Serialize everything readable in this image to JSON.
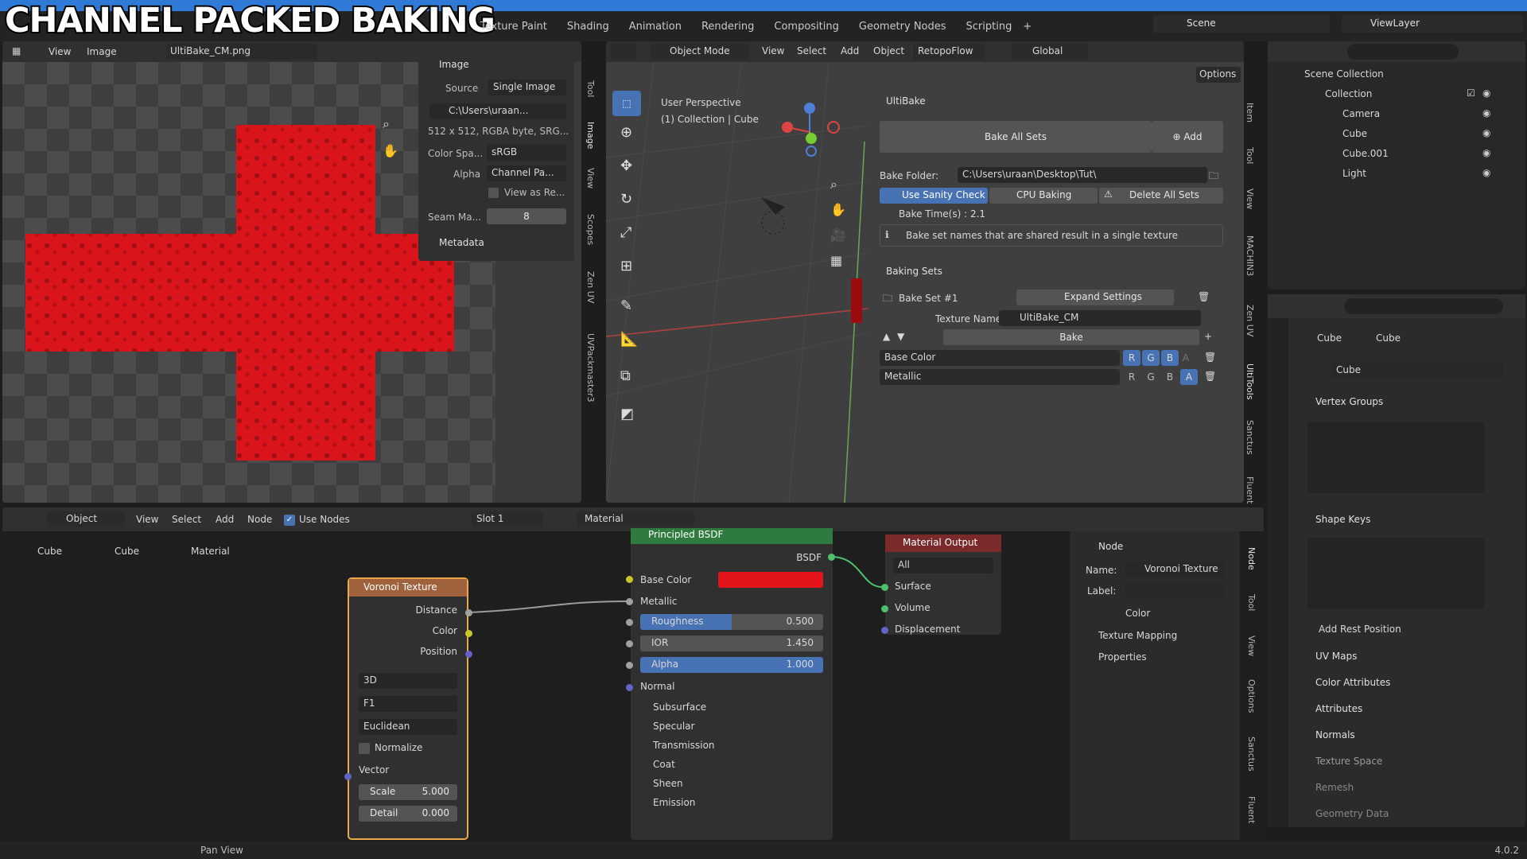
{
  "overlay": {
    "title": "CHANNEL PACKED BAKING"
  },
  "topbar": {
    "tabs": [
      "Texture Paint",
      "Shading",
      "Animation",
      "Rendering",
      "Compositing",
      "Geometry Nodes",
      "Scripting"
    ],
    "plus": "+",
    "scene": "Scene",
    "viewlayer": "ViewLayer"
  },
  "image_editor": {
    "menu": [
      "View",
      "Image"
    ],
    "image_name": "UltiBake_CM.png",
    "panel": {
      "title": "Image",
      "source_label": "Source",
      "source_value": "Single Image",
      "path": "C:\\Users\\uraan...",
      "info": "512 x 512, RGBA byte, SRG...",
      "colorspace_label": "Color Spa...",
      "colorspace_value": "sRGB",
      "alpha_label": "Alpha",
      "alpha_value": "Channel Pa...",
      "view_as": "View as Re...",
      "seam_label": "Seam Ma...",
      "seam_value": "8",
      "metadata": "Metadata"
    },
    "tabs": [
      "Tool",
      "Image",
      "View",
      "Scopes",
      "Zen UV",
      "UVPackmaster3"
    ]
  },
  "viewport": {
    "mode": "Object Mode",
    "menu": [
      "View",
      "Select",
      "Add",
      "Object"
    ],
    "retopo": "RetopoFlow",
    "orientation": "Global",
    "options": "Options",
    "perspective": "User Perspective",
    "collection": "(1) Collection | Cube",
    "tabs": [
      "Item",
      "Tool",
      "View",
      "MACHIN3",
      "Zen UV",
      "UltiTools",
      "Sanctus",
      "Fluent"
    ]
  },
  "ultibake": {
    "title": "UltiBake",
    "bake_all": "Bake All Sets",
    "add": "Add",
    "folder_label": "Bake Folder:",
    "folder_value": "C:\\Users\\uraan\\Desktop\\Tut\\",
    "sanity": "Use Sanity Check",
    "cpu": "CPU Baking",
    "delete_all": "Delete All Sets",
    "bake_time": "Bake Time(s) : 2.1",
    "note": "Bake set names that are shared result in a single texture",
    "sets_title": "Baking Sets",
    "set_name": "Bake Set #1",
    "expand": "Expand Settings",
    "texture_label": "Texture Name :",
    "texture_value": "UltiBake_CM",
    "bake": "Bake",
    "rows": [
      {
        "map": "Base Color",
        "channels": [
          "R",
          "G",
          "B",
          "A"
        ],
        "active": [
          true,
          true,
          true,
          false
        ]
      },
      {
        "map": "Metallic",
        "channels": [
          "R",
          "G",
          "B",
          "A"
        ],
        "active": [
          false,
          false,
          false,
          true
        ]
      }
    ]
  },
  "outliner": {
    "title": "Scene Collection",
    "items": [
      "Collection",
      "Camera",
      "Cube",
      "Cube.001",
      "Light"
    ]
  },
  "properties": {
    "crumb_obj": "Cube",
    "crumb_mesh": "Cube",
    "mesh_name": "Cube",
    "sections": {
      "vertex_groups": "Vertex Groups",
      "shape_keys": "Shape Keys",
      "add_rest": "Add Rest Position",
      "uv_maps": "UV Maps",
      "color_attr": "Color Attributes",
      "attributes": "Attributes",
      "normals": "Normals",
      "texture_space": "Texture Space",
      "remesh": "Remesh",
      "geometry_data": "Geometry Data"
    }
  },
  "node_editor": {
    "object": "Object",
    "menu": [
      "View",
      "Select",
      "Add",
      "Node"
    ],
    "use_nodes": "Use Nodes",
    "slot": "Slot 1",
    "material": "Material",
    "crumbs": [
      "Cube",
      "Cube",
      "Material"
    ],
    "voronoi": {
      "title": "Voronoi Texture",
      "outputs": [
        "Distance",
        "Color",
        "Position"
      ],
      "dims": "3D",
      "feature": "F1",
      "metric": "Euclidean",
      "normalize": "Normalize",
      "vector": "Vector",
      "scale_label": "Scale",
      "scale_value": "5.000",
      "detail_label": "Detail",
      "detail_value": "0.000"
    },
    "bsdf": {
      "title": "Principled BSDF",
      "output": "BSDF",
      "base_color": "Base Color",
      "metallic": "Metallic",
      "roughness_label": "Roughness",
      "roughness_value": "0.500",
      "roughness_fill": 0.5,
      "ior_label": "IOR",
      "ior_value": "1.450",
      "alpha_label": "Alpha",
      "alpha_value": "1.000",
      "normal": "Normal",
      "subs": [
        "Subsurface",
        "Specular",
        "Transmission",
        "Coat",
        "Sheen",
        "Emission"
      ]
    },
    "output": {
      "title": "Material Output",
      "target": "All",
      "inputs": [
        "Surface",
        "Volume",
        "Displacement"
      ]
    },
    "sidebar": {
      "title": "Node",
      "name_label": "Name:",
      "name_value": "Voronoi Texture",
      "label_label": "Label:",
      "color": "Color",
      "texture_mapping": "Texture Mapping",
      "properties": "Properties"
    },
    "tabs": [
      "Node",
      "Tool",
      "View",
      "Options",
      "Sanctus",
      "Fluent"
    ]
  },
  "statusbar": {
    "action": "Pan View",
    "version": "4.0.2"
  },
  "colors": {
    "accent": "#4772b3",
    "red": "#e3141c",
    "header": "#303030"
  }
}
